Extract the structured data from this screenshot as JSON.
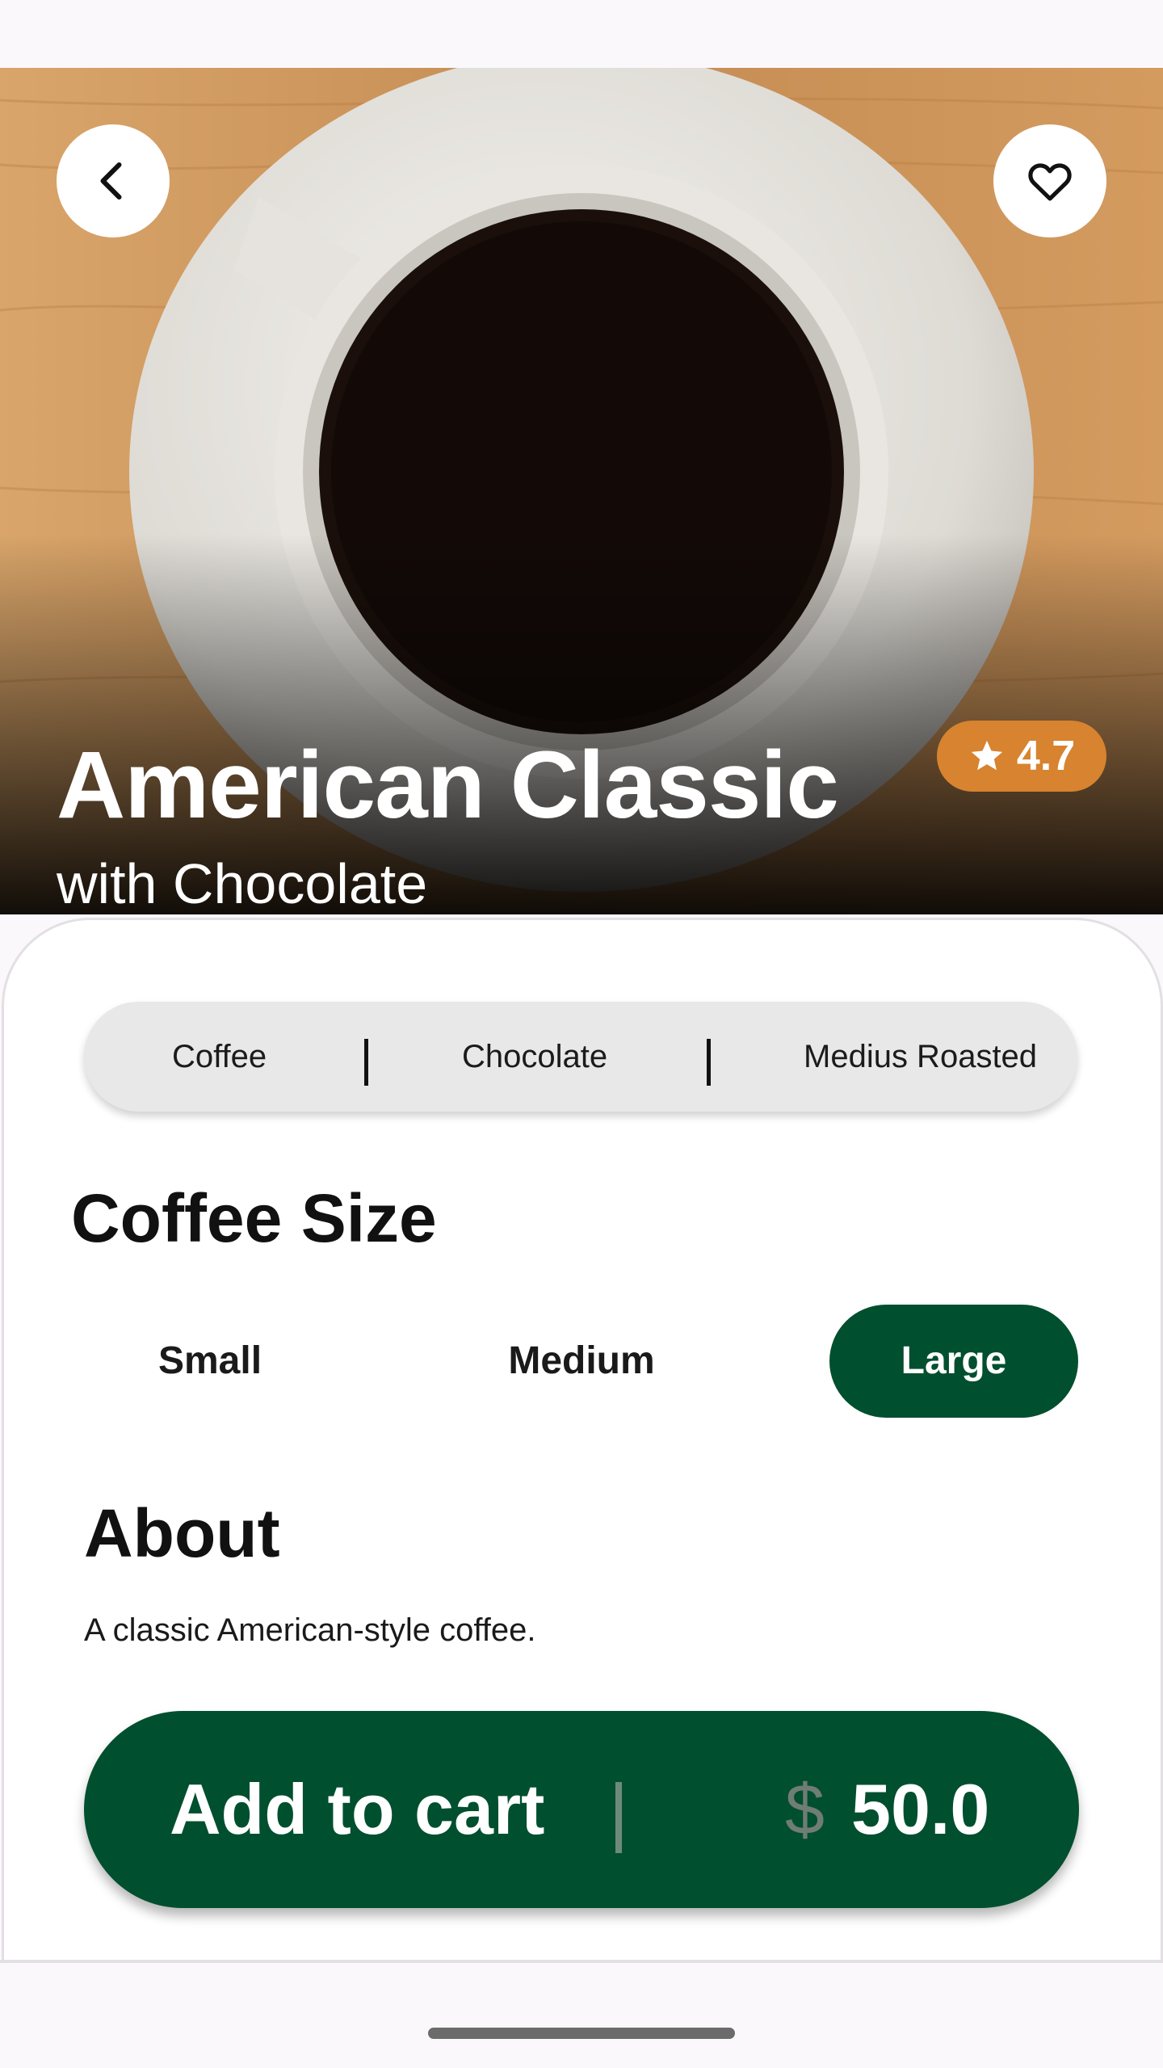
{
  "product": {
    "name": "American Classic",
    "subtitle": "with Chocolate",
    "rating": "4.7"
  },
  "tags": [
    "Coffee",
    "Chocolate",
    "Medius Roasted"
  ],
  "size": {
    "title": "Coffee Size",
    "options": [
      "Small",
      "Medium",
      "Large"
    ],
    "selected": "Large"
  },
  "about": {
    "title": "About",
    "text": "A classic American-style coffee."
  },
  "cart": {
    "label": "Add to cart",
    "currency": "$",
    "price": "50.0"
  },
  "icons": {
    "back": "chevron-left-icon",
    "favorite": "heart-outline-icon",
    "rating": "star-icon"
  },
  "colors": {
    "primary": "#004f2f",
    "rating_badge": "#d7832f"
  }
}
